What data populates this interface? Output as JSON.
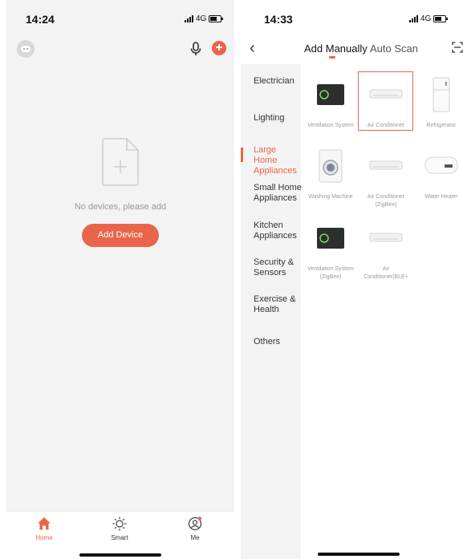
{
  "left": {
    "status": {
      "time": "14:24",
      "network": "4G"
    },
    "empty_text": "No devices, please add",
    "add_device_label": "Add Device",
    "tabs": [
      {
        "label": "Home",
        "icon": "home-icon",
        "active": true
      },
      {
        "label": "Smart",
        "icon": "sun-icon",
        "active": false
      },
      {
        "label": "Me",
        "icon": "user-circle-icon",
        "active": false
      }
    ]
  },
  "right": {
    "status": {
      "time": "14:33",
      "network": "4G"
    },
    "tab_manual": "Add Manually",
    "tab_scan": "Auto Scan",
    "categories": [
      {
        "label": "Electrician",
        "active": false
      },
      {
        "label": "Lighting",
        "active": false
      },
      {
        "label": "Large Home Appliances",
        "active": true
      },
      {
        "label": "Small Home Appliances",
        "active": false
      },
      {
        "label": "Kitchen Appliances",
        "active": false
      },
      {
        "label": "Security & Sensors",
        "active": false
      },
      {
        "label": "Exercise & Health",
        "active": false
      },
      {
        "label": "Others",
        "active": false
      }
    ],
    "devices": [
      {
        "label": "Ventilation System",
        "icon": "ventilation-icon"
      },
      {
        "label": "Air Conditioner",
        "icon": "air-conditioner-icon",
        "selected": true
      },
      {
        "label": "Refrigerator",
        "icon": "refrigerator-icon"
      },
      {
        "label": "Washing Machine",
        "icon": "washing-machine-icon"
      },
      {
        "label": "Air Conditioner (ZigBee)",
        "icon": "air-conditioner-icon"
      },
      {
        "label": "Water Heater",
        "icon": "water-heater-icon"
      },
      {
        "label": "Ventilation System (ZigBee)",
        "icon": "ventilation-icon"
      },
      {
        "label": "Air Conditioner(BLE+",
        "icon": "air-conditioner-icon"
      }
    ]
  },
  "colors": {
    "accent": "#e8654a",
    "sidebar_bg": "#f3f3f3"
  }
}
